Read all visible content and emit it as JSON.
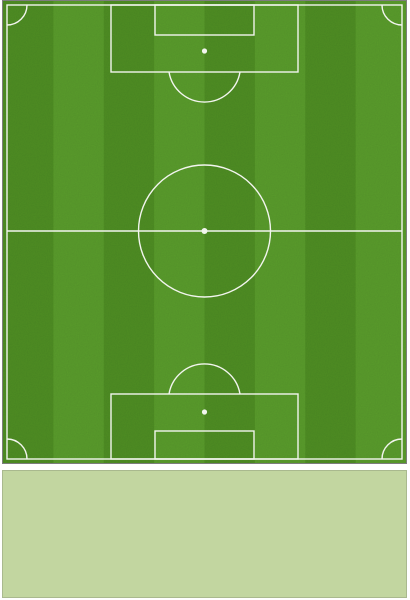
{
  "pitch": {
    "grass_colors": [
      "#4f8e24",
      "#5a9c2c"
    ],
    "line_color": "#f2f5ee",
    "stripe_count": 8,
    "orientation": "vertical"
  },
  "panel": {
    "background_color": "#c2d6a0",
    "text": ""
  }
}
